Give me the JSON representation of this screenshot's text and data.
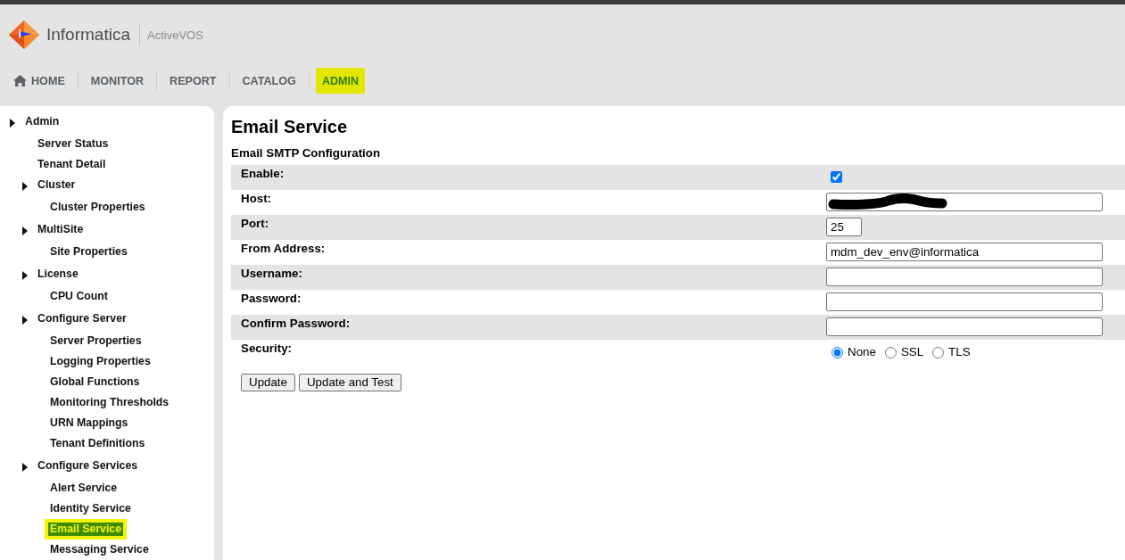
{
  "header": {
    "brand": "Informatica",
    "product": "ActiveVOS"
  },
  "nav": [
    {
      "label": "HOME",
      "kind": "home",
      "selected": false
    },
    {
      "label": "MONITOR",
      "kind": "link",
      "selected": false
    },
    {
      "label": "REPORT",
      "kind": "link",
      "selected": false
    },
    {
      "label": "CATALOG",
      "kind": "link",
      "selected": false
    },
    {
      "label": "ADMIN",
      "kind": "link",
      "selected": true
    }
  ],
  "sidebar": {
    "items": [
      {
        "label": "Admin",
        "selected": false,
        "children": [
          {
            "label": "Server Status",
            "selected": false
          },
          {
            "label": "Tenant Detail",
            "selected": false
          },
          {
            "label": "Cluster",
            "selected": false,
            "children": [
              {
                "label": "Cluster Properties",
                "selected": false
              }
            ]
          },
          {
            "label": "MultiSite",
            "selected": false,
            "children": [
              {
                "label": "Site Properties",
                "selected": false
              }
            ]
          },
          {
            "label": "License",
            "selected": false,
            "children": [
              {
                "label": "CPU Count",
                "selected": false
              }
            ]
          },
          {
            "label": "Configure Server",
            "selected": false,
            "children": [
              {
                "label": "Server Properties",
                "selected": false
              },
              {
                "label": "Logging Properties",
                "selected": false
              },
              {
                "label": "Global Functions",
                "selected": false
              },
              {
                "label": "Monitoring Thresholds",
                "selected": false
              },
              {
                "label": "URN Mappings",
                "selected": false
              },
              {
                "label": "Tenant Definitions",
                "selected": false
              }
            ]
          },
          {
            "label": "Configure Services",
            "selected": false,
            "children": [
              {
                "label": "Alert Service",
                "selected": false
              },
              {
                "label": "Identity Service",
                "selected": false
              },
              {
                "label": "Email Service",
                "selected": true
              },
              {
                "label": "Messaging Service",
                "selected": false
              }
            ]
          }
        ]
      }
    ]
  },
  "page": {
    "title": "Email Service",
    "section": "Email SMTP Configuration",
    "fields": [
      {
        "label": "Enable:",
        "kind": "checkbox",
        "checked": true
      },
      {
        "label": "Host:",
        "kind": "text",
        "redacted": true
      },
      {
        "label": "Port:",
        "kind": "number",
        "value": "25"
      },
      {
        "label": "From Address:",
        "kind": "text",
        "value": "mdm_dev_env@informatica"
      },
      {
        "label": "Username:",
        "kind": "text"
      },
      {
        "label": "Password:",
        "kind": "password"
      },
      {
        "label": "Confirm Password:",
        "kind": "password"
      },
      {
        "label": "Security:",
        "kind": "radio",
        "options": [
          {
            "label": "None",
            "selected": true
          },
          {
            "label": "SSL",
            "selected": false
          },
          {
            "label": "TLS",
            "selected": false
          }
        ]
      }
    ],
    "buttons": [
      "Update",
      "Update and Test"
    ]
  }
}
